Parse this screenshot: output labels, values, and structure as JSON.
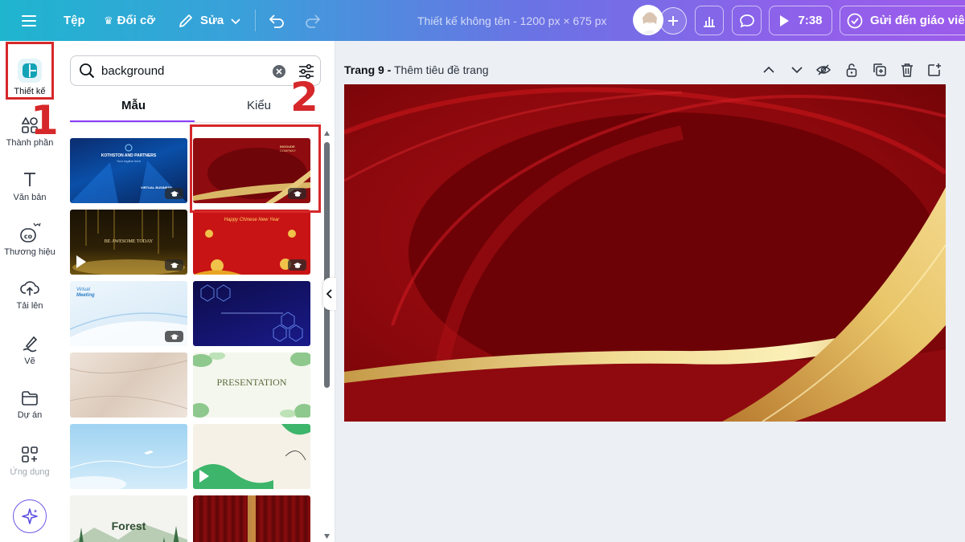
{
  "topbar": {
    "menu_icon": "hamburger-icon",
    "file": "Tệp",
    "resize": "Đổi cỡ",
    "edit": "Sửa",
    "title": "Thiết kế không tên - 1200 px × 675 px",
    "timer": "7:38",
    "send": "Gửi đến giáo viên"
  },
  "rail": {
    "items": [
      {
        "label": "Thiết kế",
        "icon": "design-icon"
      },
      {
        "label": "Thành phần",
        "icon": "elements-icon"
      },
      {
        "label": "Văn bản",
        "icon": "text-icon"
      },
      {
        "label": "Thương hiệu",
        "icon": "brand-icon"
      },
      {
        "label": "Tải lên",
        "icon": "upload-icon"
      },
      {
        "label": "Vẽ",
        "icon": "draw-icon"
      },
      {
        "label": "Dự án",
        "icon": "folder-icon"
      },
      {
        "label": "Ứng dụng",
        "icon": "apps-icon"
      }
    ]
  },
  "annotations": {
    "step1": "1",
    "step2": "2"
  },
  "panel": {
    "search_value": "background",
    "tabs": [
      "Mẫu",
      "Kiểu"
    ],
    "templates": [
      {
        "name": "blue-business-template",
        "texts": [
          "KOTHSTON AND PARTNERS",
          "Your tagline here",
          "VIRTUAL BUSINESS"
        ]
      },
      {
        "name": "red-gold-template",
        "texts": [
          "INGOUDE",
          "COMPANY"
        ]
      },
      {
        "name": "gold-lights-template",
        "texts": [
          "BE AWESOME TODAY"
        ]
      },
      {
        "name": "chinese-new-year-template",
        "texts": [
          "Happy Chinese New Year"
        ]
      },
      {
        "name": "virtual-meeting-template",
        "texts": [
          "Virtual",
          "Meeting"
        ]
      },
      {
        "name": "hexagon-template",
        "texts": []
      },
      {
        "name": "marble-template",
        "texts": []
      },
      {
        "name": "presentation-template",
        "texts": [
          "PRESENTATION"
        ]
      },
      {
        "name": "sky-template",
        "texts": []
      },
      {
        "name": "doodle-template",
        "texts": []
      },
      {
        "name": "forest-template",
        "texts": [
          "Forest"
        ]
      },
      {
        "name": "curtain-template",
        "texts": []
      }
    ]
  },
  "canvas": {
    "page_number": "Trang 9 -",
    "page_title_placeholder": "Thêm tiêu đề trang"
  },
  "colors": {
    "accent": "#8b3dff",
    "annotation": "#d6282a",
    "canvas_red": "#8a0a0e",
    "gold": "#e2c577"
  }
}
